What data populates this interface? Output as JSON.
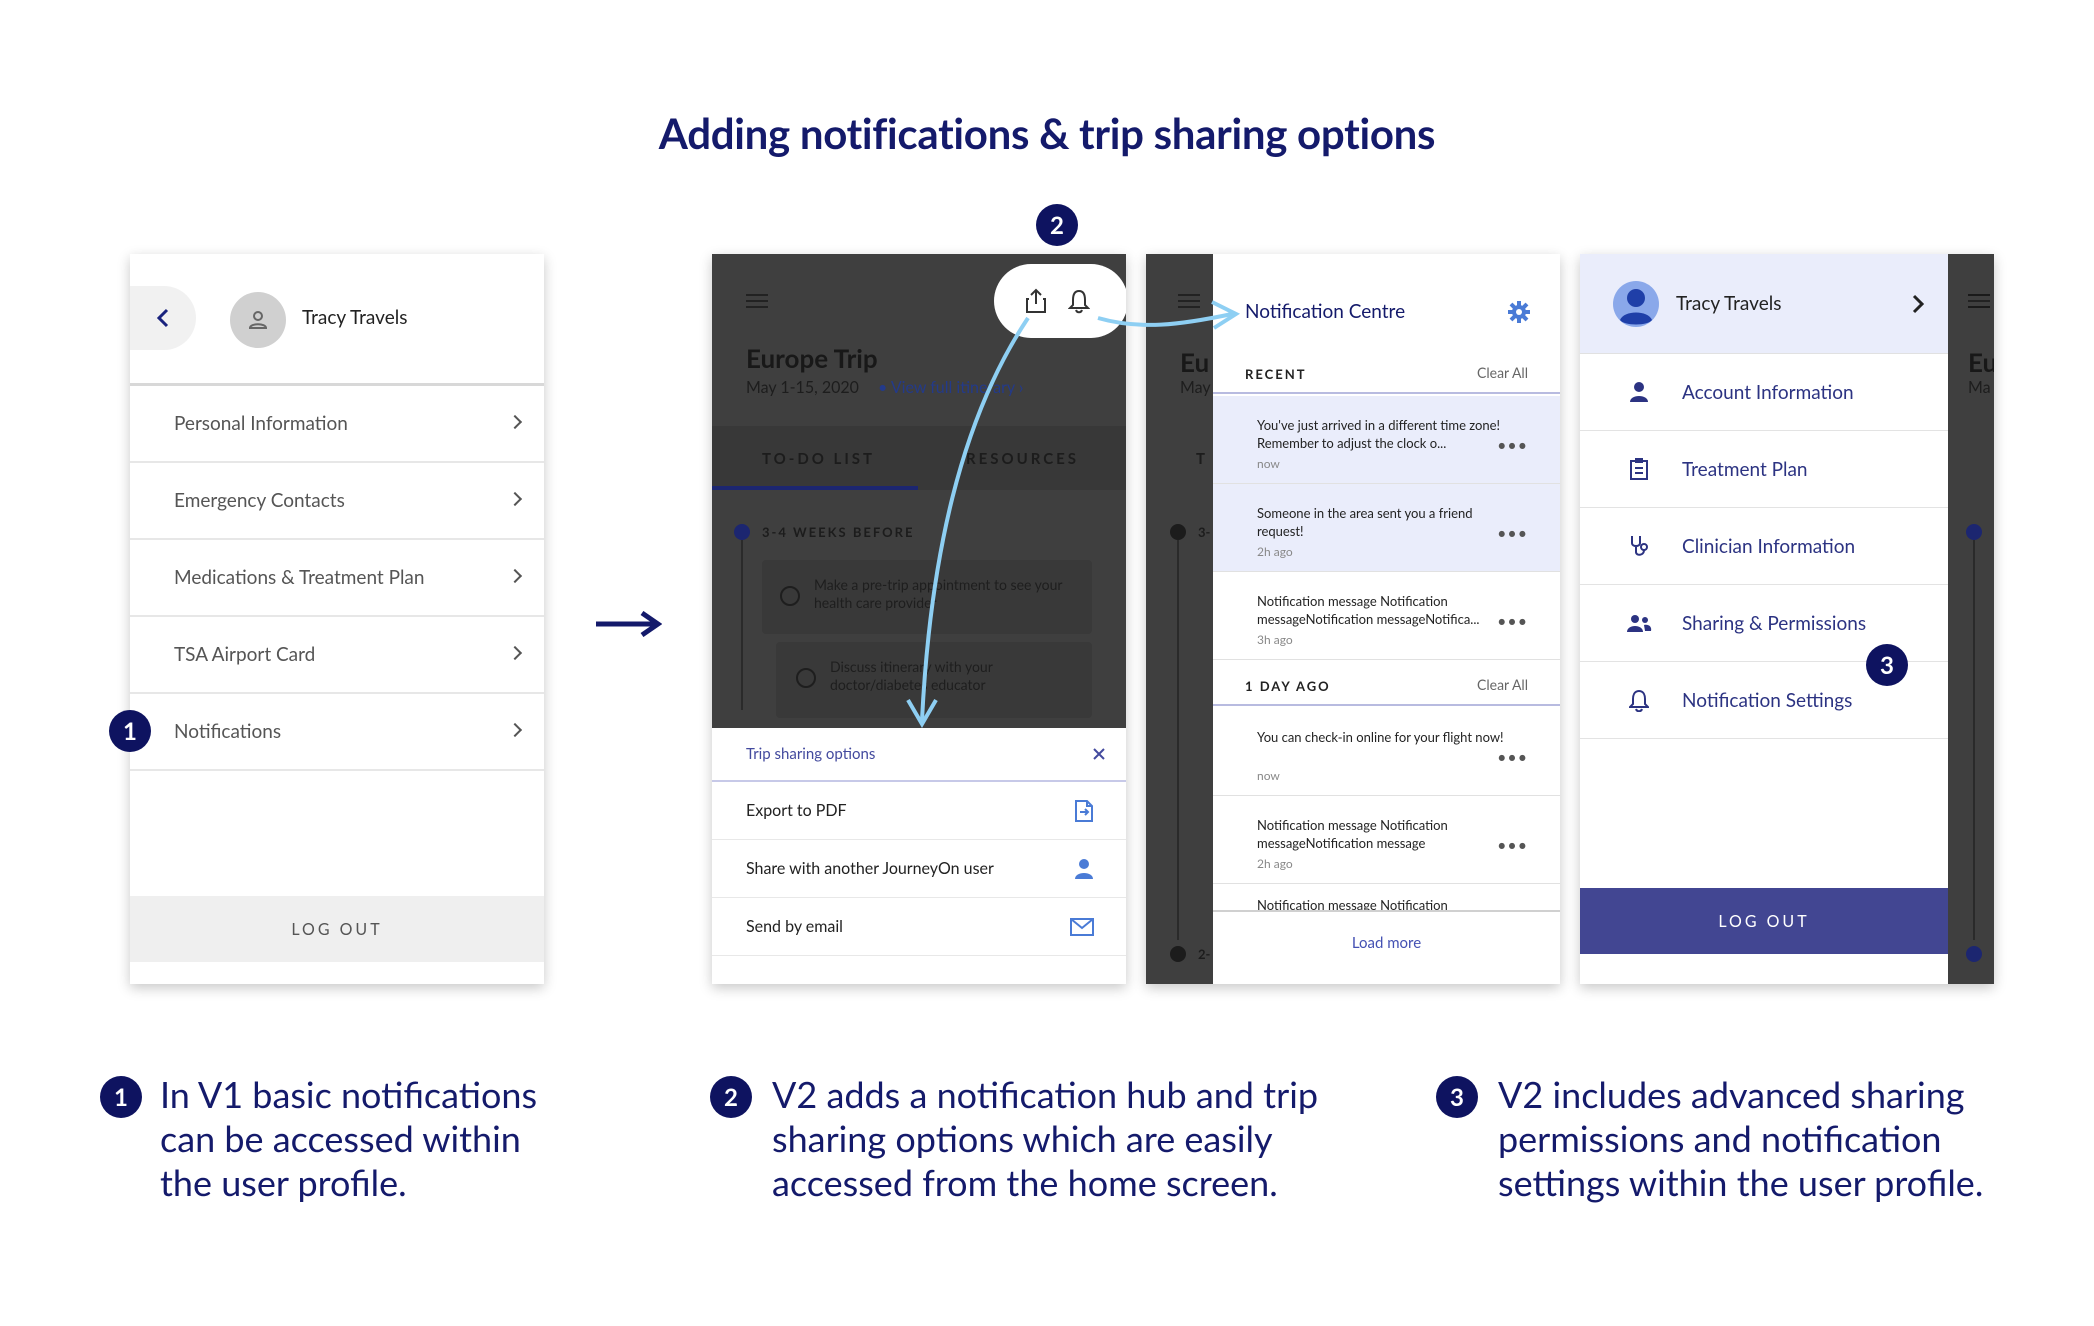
{
  "title": "Adding notifications & trip sharing options",
  "badges": {
    "one": "1",
    "two": "2",
    "three": "3"
  },
  "v1_profile": {
    "user_name": "Tracy Travels",
    "menu": [
      {
        "label": "Personal Information"
      },
      {
        "label": "Emergency Contacts"
      },
      {
        "label": "Medications & Treatment Plan"
      },
      {
        "label": "TSA Airport Card"
      },
      {
        "label": "Notifications"
      }
    ],
    "logout_label": "LOG OUT"
  },
  "v2_home": {
    "trip_title": "Europe Trip",
    "trip_dates": "May 1-15, 2020",
    "itinerary_link": "View full itinerary",
    "tabs": [
      "TO-DO LIST",
      "RESOURCES"
    ],
    "section_label": "3-4 WEEKS BEFORE",
    "tasks": [
      "Make a pre-trip appointment to see your health care provider",
      "Discuss itinerary with your doctor/diabetes educator"
    ],
    "sharing_sheet": {
      "title": "Trip sharing options",
      "options": [
        {
          "label": "Export to PDF",
          "icon": "pdf-export-icon"
        },
        {
          "label": "Share with another JourneyOn user",
          "icon": "user-icon"
        },
        {
          "label": "Send by email",
          "icon": "mail-icon"
        }
      ]
    }
  },
  "notification_centre": {
    "title": "Notification Centre",
    "sections": [
      {
        "label": "RECENT",
        "clear": "Clear All"
      },
      {
        "label": "1 DAY AGO",
        "clear": "Clear All"
      }
    ],
    "recent": [
      {
        "message": "You've just arrived in a different time zone! Remember to adjust the clock o...",
        "time": "now"
      },
      {
        "message": "Someone in the area sent you a friend request!",
        "time": "2h ago"
      },
      {
        "message": "Notification message Notification messageNotification messageNotifica...",
        "time": "3h ago"
      }
    ],
    "day_ago": [
      {
        "message": "You can check-in online for your flight now!",
        "time": "now"
      },
      {
        "message": "Notification message Notification messageNotification message",
        "time": "2h ago"
      },
      {
        "message": "Notification message Notification"
      }
    ],
    "load_more": "Load more"
  },
  "v2_profile": {
    "user_name": "Tracy Travels",
    "menu": [
      {
        "label": "Account Information",
        "icon": "person-icon"
      },
      {
        "label": "Treatment Plan",
        "icon": "clipboard-icon"
      },
      {
        "label": "Clinician Information",
        "icon": "stethoscope-icon"
      },
      {
        "label": "Sharing & Permissions",
        "icon": "people-icon"
      },
      {
        "label": "Notification Settings",
        "icon": "bell-icon"
      }
    ],
    "logout_label": "LOG OUT"
  },
  "captions": [
    {
      "num": "1",
      "text": "In V1 basic notifications can be accessed within the user profile."
    },
    {
      "num": "2",
      "text": "V2 adds a notification hub and trip sharing options which are easily accessed from the home screen."
    },
    {
      "num": "3",
      "text": "V2 includes advanced sharing permissions and notification settings within the user profile."
    }
  ],
  "colors": {
    "navy": "#141a6b",
    "badge": "#0e1360",
    "accent": "#424692",
    "highlight": "#eaedfb",
    "arrow": "#8ecff3"
  }
}
